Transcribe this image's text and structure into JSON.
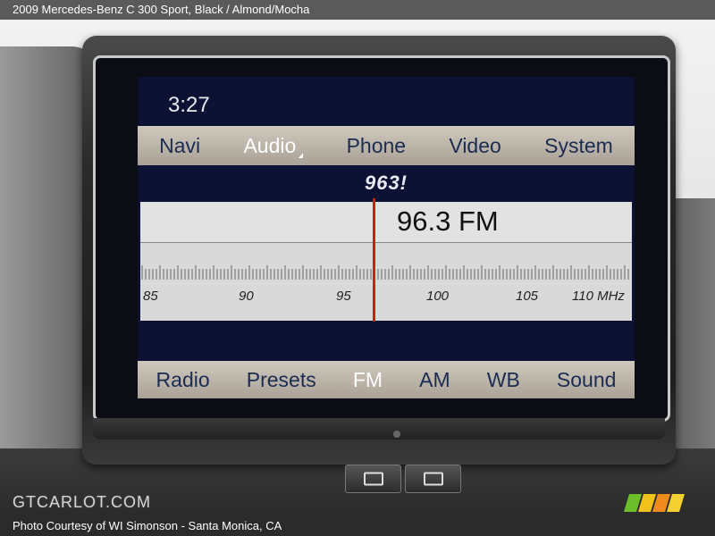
{
  "header": {
    "title": "2009 Mercedes-Benz C 300 Sport,  Black / Almond/Mocha"
  },
  "screen": {
    "clock": "3:27",
    "top_menu": [
      "Navi",
      "Audio",
      "Phone",
      "Video",
      "System"
    ],
    "top_menu_active": "Audio",
    "station_name": "963!",
    "frequency": "96.3 FM",
    "frequency_value": 96.3,
    "band_scale": {
      "min": 85,
      "max": 110,
      "labels": [
        "85",
        "90",
        "95",
        "100",
        "105",
        "110 MHz"
      ]
    },
    "bottom_menu": [
      "Radio",
      "Presets",
      "FM",
      "AM",
      "WB",
      "Sound"
    ],
    "bottom_menu_active": "FM"
  },
  "watermark": "GTCARLOT.COM",
  "footer": {
    "credit": "Photo Courtesy of WI Simonson - Santa Monica, CA"
  },
  "colors": {
    "menu_text": "#1b2c52",
    "screen_bg": "#0d1133",
    "needle": "#c42418"
  },
  "icons": [
    "radio-needle-icon",
    "seat-button-icon",
    "phone-button-icon",
    "gtcarlot-logo-icon"
  ]
}
